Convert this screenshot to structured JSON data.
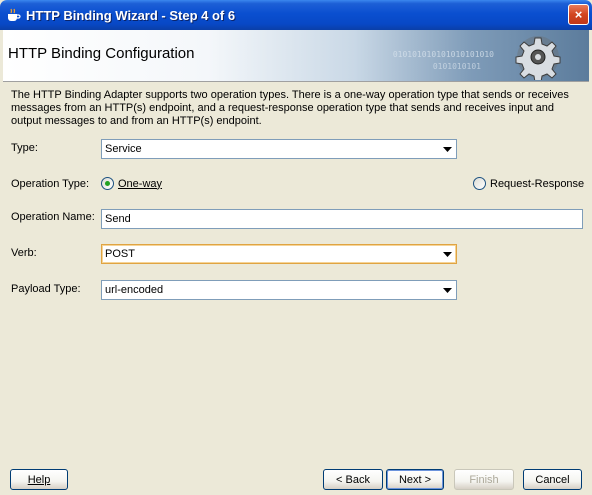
{
  "window": {
    "title": "HTTP Binding Wizard - Step 4 of 6",
    "close_label": "×"
  },
  "banner": {
    "heading": "HTTP Binding Configuration",
    "binary_text_1": "010101010101010101010",
    "binary_text_2": "0101010101"
  },
  "description": "The HTTP Binding Adapter supports two operation types.  There is a one-way operation type that sends or receives messages from an HTTP(s) endpoint, and a request-response operation type that sends and receives input and output messages to and from an HTTP(s) endpoint.",
  "form": {
    "type_label": "Type:",
    "type_value": "Service",
    "operation_type_label": "Operation Type:",
    "radio_one_way": "One-way",
    "radio_one_way_selected": true,
    "radio_request_response": "Request-Response",
    "operation_name_label": "Operation Name:",
    "operation_name_value": "Send",
    "verb_label": "Verb:",
    "verb_value": "POST",
    "payload_type_label": "Payload Type:",
    "payload_type_value": "url-encoded"
  },
  "buttons": {
    "help": "Help",
    "back": "< Back",
    "next": "Next >",
    "finish": "Finish",
    "cancel": "Cancel"
  }
}
